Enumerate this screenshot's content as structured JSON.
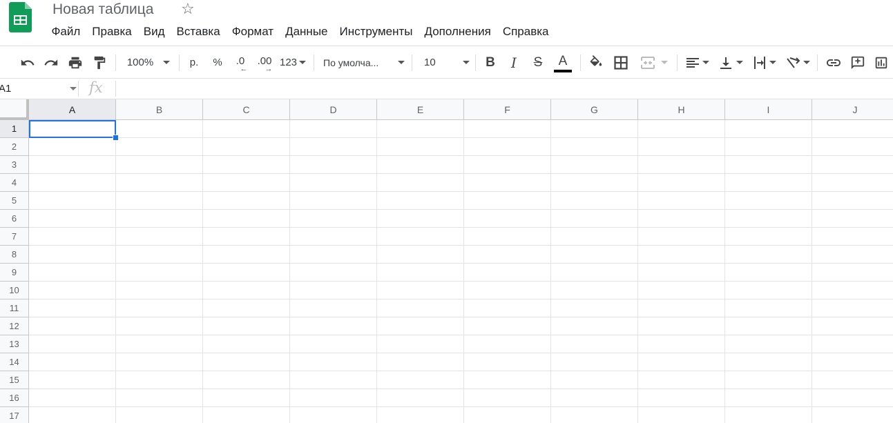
{
  "app": {
    "title": "Новая таблица",
    "accent_color": "#0f9d58",
    "selection_color": "#1a73e8",
    "logo_icon": "sheets-logo-icon",
    "star_icon": "star-outline-icon"
  },
  "menu": {
    "items": [
      "Файл",
      "Правка",
      "Вид",
      "Вставка",
      "Формат",
      "Данные",
      "Инструменты",
      "Дополнения",
      "Справка"
    ]
  },
  "toolbar": {
    "zoom": "100%",
    "currency": "р.",
    "percent": "%",
    "decrease_decimals": ".0",
    "increase_decimals": ".00",
    "number_format": "123",
    "font": "По умолча...",
    "font_size": "10",
    "bold": "B",
    "italic": "I",
    "strikethrough": "S",
    "text_color_letter": "A",
    "text_color": "#000000",
    "icons": [
      "undo-icon",
      "redo-icon",
      "print-icon",
      "paint-format-icon",
      "fill-color-icon",
      "borders-icon",
      "merge-cells-icon",
      "horizontal-align-icon",
      "vertical-align-icon",
      "text-wrap-icon",
      "text-rotation-icon",
      "insert-link-icon",
      "insert-comment-icon",
      "insert-chart-icon"
    ]
  },
  "formula_bar": {
    "name_box": "A1",
    "fx_label": "fx",
    "value": ""
  },
  "sheet": {
    "columns": [
      "A",
      "B",
      "C",
      "D",
      "E",
      "F",
      "G",
      "H",
      "I",
      "J"
    ],
    "rows": [
      "1",
      "2",
      "3",
      "4",
      "5",
      "6",
      "7",
      "8",
      "9",
      "10",
      "11",
      "12",
      "13",
      "14",
      "15",
      "16",
      "17"
    ],
    "selected_cell": "A1",
    "selected_column": "A",
    "selected_row": "1"
  }
}
